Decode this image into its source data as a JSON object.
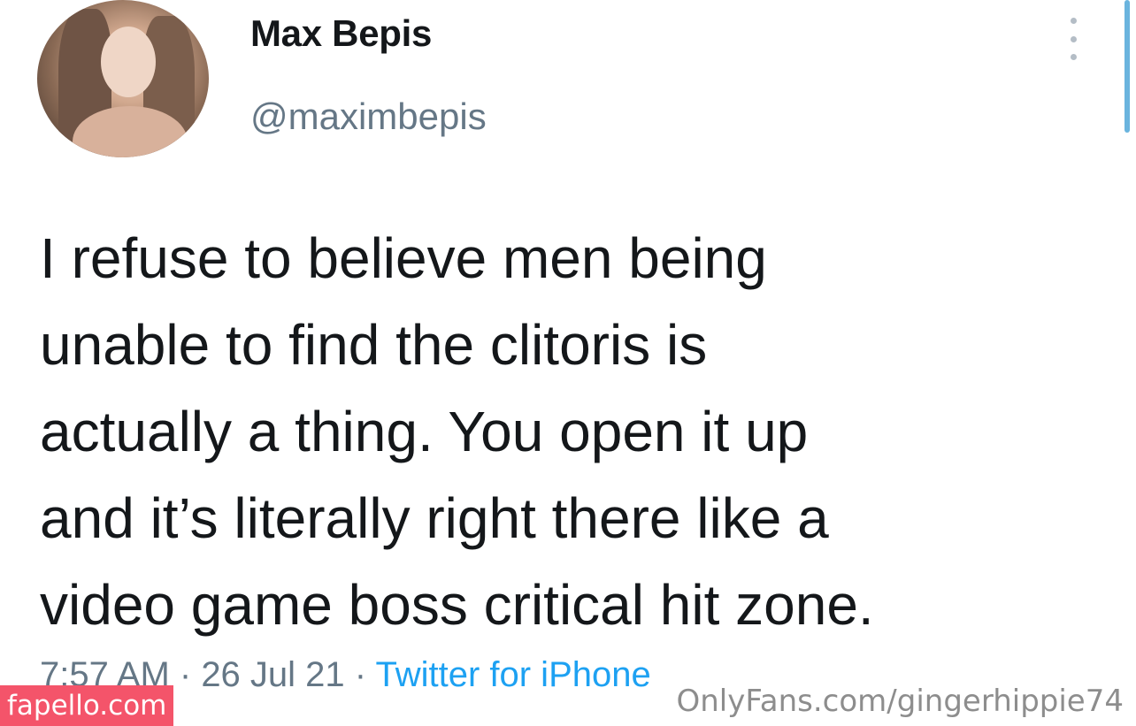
{
  "tweet": {
    "display_name": "Max Bepis",
    "handle": "@maximbepis",
    "text_lines": [
      "I refuse to believe men being",
      "unable to find the clitoris is",
      "actually a thing. You open it up",
      "and it’s literally right there like a",
      "video game boss critical hit zone."
    ],
    "time": "7:57 AM",
    "sep1": " · ",
    "date": "26 Jul 21",
    "sep2": " · ",
    "source": "Twitter for iPhone",
    "avatar_icon": "user-avatar",
    "more_icon": "more-dots-vertical"
  },
  "watermarks": {
    "left": "fapello.com",
    "right": "OnlyFans.com/gingerhippie74"
  },
  "colors": {
    "name": "#14171a",
    "secondary": "#657786",
    "link": "#1da1f2",
    "watermark_bg": "#f4546a"
  }
}
